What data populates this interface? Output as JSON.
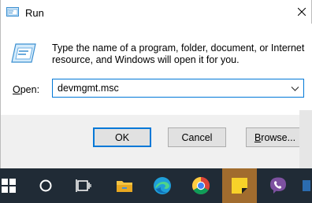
{
  "dialog": {
    "title": "Run",
    "description": "Type the name of a program, folder, document, or Internet resource, and Windows will open it for you.",
    "open_label_key": "O",
    "open_label_rest": "pen:",
    "input_value": "devmgmt.msc",
    "ok_label": "OK",
    "cancel_label": "Cancel",
    "browse_key": "B",
    "browse_rest": "rowse...",
    "icons": {
      "title": "run-icon",
      "close": "close-icon",
      "large": "run-icon",
      "dropdown": "chevron-down-icon"
    }
  },
  "taskbar": {
    "items": [
      "start-icon",
      "search-icon",
      "task-view-icon",
      "file-explorer-icon",
      "edge-icon",
      "chrome-icon",
      "sticky-notes-icon",
      "viber-icon"
    ],
    "active_item": "sticky-notes-icon"
  },
  "colors": {
    "accent": "#0078d7",
    "taskbar": "#202b36",
    "active_taskbar_item": "#a16c2e",
    "button_area": "#f0f0f0"
  }
}
